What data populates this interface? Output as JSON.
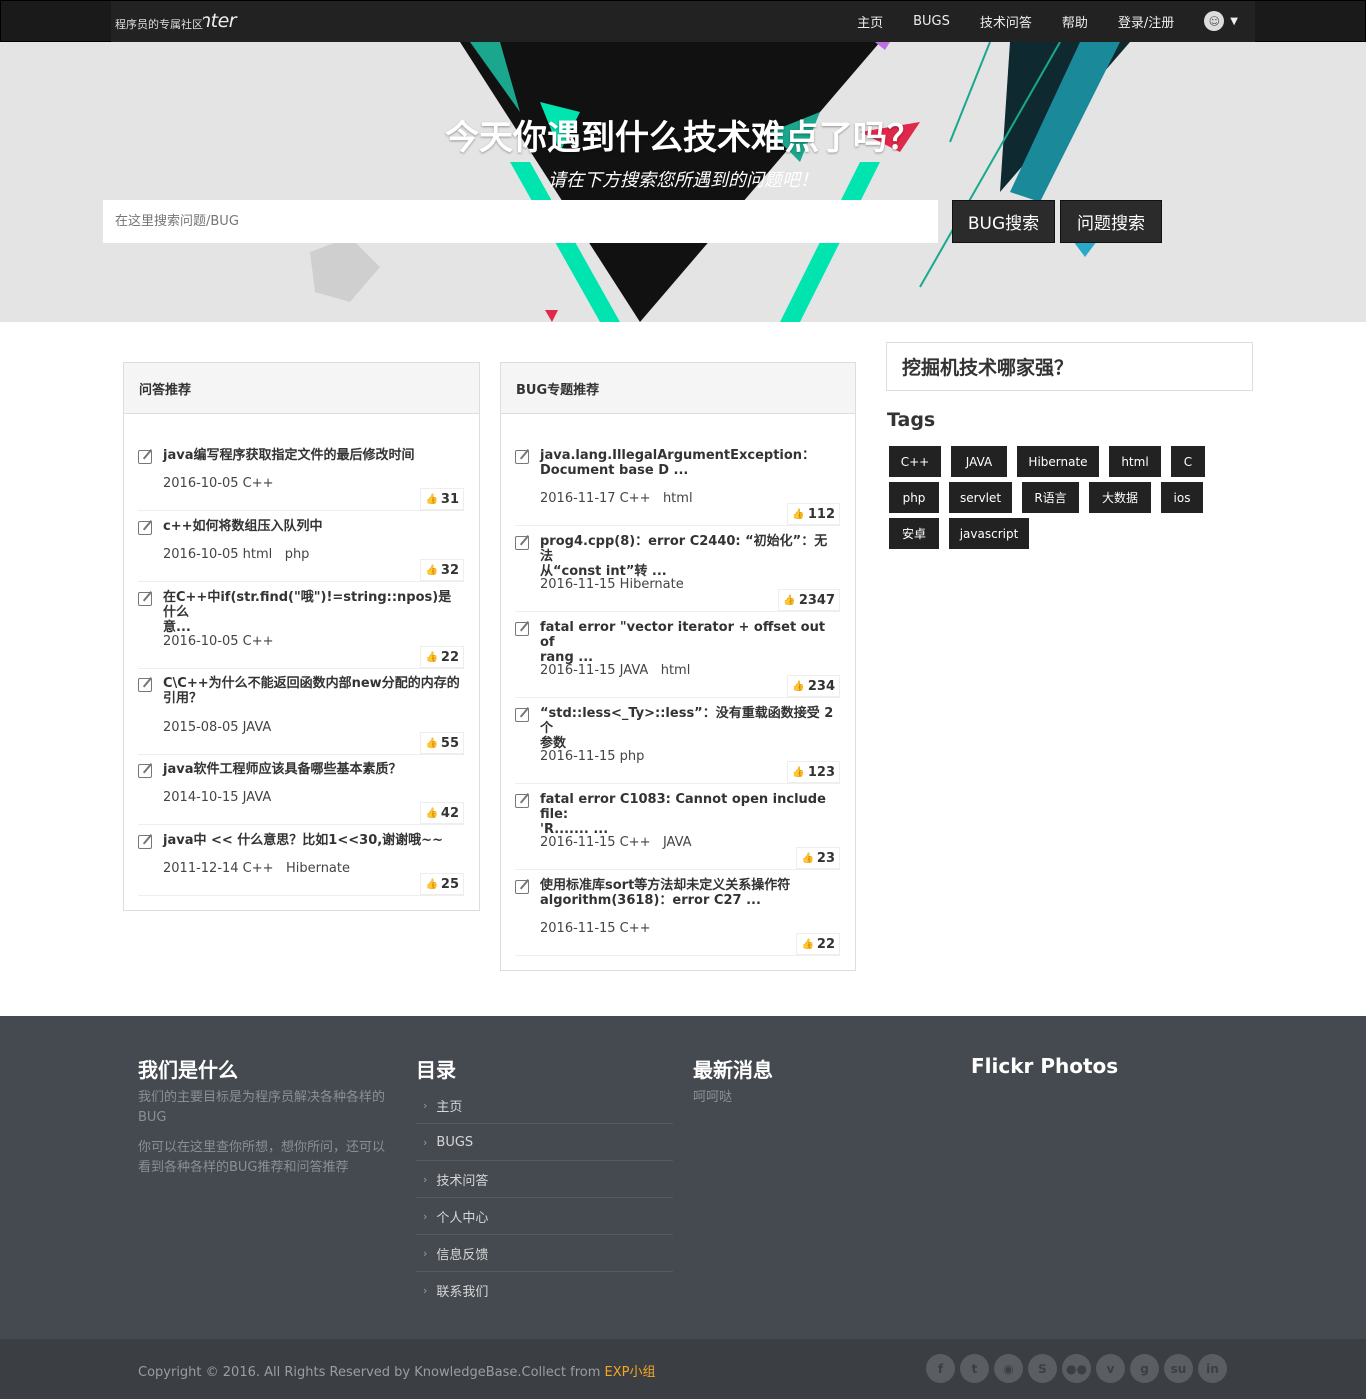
{
  "navbar": {
    "brand": "nullpointer",
    "tagline": "程序员的专属社区",
    "links": [
      "主页",
      "BUGS",
      "技术问答",
      "帮助",
      "登录/注册"
    ]
  },
  "hero": {
    "title": "今天你遇到什么技术难点了吗？",
    "subtitle": "请在下方搜索您所遇到的问题吧！",
    "search_placeholder": "在这里搜索问题/BUG",
    "bug_search": "BUG搜索",
    "question_search": "问题搜索"
  },
  "qa_panel": {
    "title": "问答推荐",
    "items": [
      {
        "title": "java编写程序获取指定文件的最后修改时间",
        "title2": "",
        "meta": "2016-10-05 C++",
        "likes": "31"
      },
      {
        "title": "c++如何将数组压入队列中",
        "title2": "",
        "meta": "2016-10-05 html   php",
        "likes": "32"
      },
      {
        "title": "在C++中if(str.find(\"哦\")!=string::npos)是什么",
        "title2": "意...",
        "meta": "2016-10-05 C++",
        "likes": "22"
      },
      {
        "title": "C\\C++为什么不能返回函数内部new分配的内存的",
        "title2": "引用？",
        "meta": "2015-08-05 JAVA",
        "likes": "55"
      },
      {
        "title": "java软件工程师应该具备哪些基本素质？",
        "title2": "",
        "meta": "2014-10-15 JAVA",
        "likes": "42"
      },
      {
        "title": "java中 << 什么意思？比如1<<30,谢谢哦~~",
        "title2": "",
        "meta": "2011-12-14 C++   Hibernate",
        "likes": "25"
      }
    ]
  },
  "bug_panel": {
    "title": "BUG专题推荐",
    "items": [
      {
        "title": "java.lang.IllegalArgumentException：",
        "title2": "Document base D ...",
        "meta": "2016-11-17 C++   html",
        "likes": "112"
      },
      {
        "title": "prog4.cpp(8)：error C2440: “初始化”：无法",
        "title2": "从“const int”转 ...",
        "meta": "2016-11-15 Hibernate",
        "likes": "2347"
      },
      {
        "title": "fatal error \"vector iterator + offset out of",
        "title2": "rang ...",
        "meta": "2016-11-15 JAVA   html",
        "likes": "234"
      },
      {
        "title": "“std::less<_Ty>::less”：没有重载函数接受 2 个",
        "title2": "参数",
        "meta": "2016-11-15 php",
        "likes": "123"
      },
      {
        "title": "fatal error C1083: Cannot open include file:",
        "title2": "'R....... ...",
        "meta": "2016-11-15 C++   JAVA",
        "likes": "23"
      },
      {
        "title": "使用标准库sort等方法却未定义关系操作符",
        "title2": "algorithm(3618)：error C27 ...",
        "meta": "2016-11-15 C++",
        "likes": "22"
      }
    ]
  },
  "sidebar": {
    "question": "挖掘机技术哪家强？",
    "tags_title": "Tags",
    "tags": [
      "C++",
      "JAVA",
      "Hibernate",
      "html",
      "C",
      "php",
      "servlet",
      "R语言",
      "大数据",
      "ios",
      "安卓",
      "javascript"
    ]
  },
  "footer": {
    "about_title": "我们是什么",
    "about_p1": "我们的主要目标是为程序员解决各种各样的BUG",
    "about_p2": "你可以在这里查你所想，想你所问，还可以看到各种各样的BUG推荐和问答推荐",
    "dir_title": "目录",
    "dir_links": [
      "主页",
      "BUGS",
      "技术问答",
      "个人中心",
      "信息反馈",
      "联系我们"
    ],
    "news_title": "最新消息",
    "news_text": "呵呵哒",
    "flickr_title": "Flickr Photos",
    "copyright": "Copyright © 2016. All Rights Reserved by KnowledgeBase.Collect from ",
    "copyright_brand": "EXP小组",
    "social_icons": [
      "facebook-icon",
      "twitter-icon",
      "rss-icon",
      "skype-icon",
      "flickr-icon",
      "vimeo-icon",
      "google-plus-icon",
      "stumbleupon-icon",
      "linkedin-icon"
    ]
  },
  "colors": {
    "nav_bg": "#222222",
    "accent": "#00e5b0",
    "footer_bg": "#454a50",
    "brand_orange": "#f5a623"
  }
}
